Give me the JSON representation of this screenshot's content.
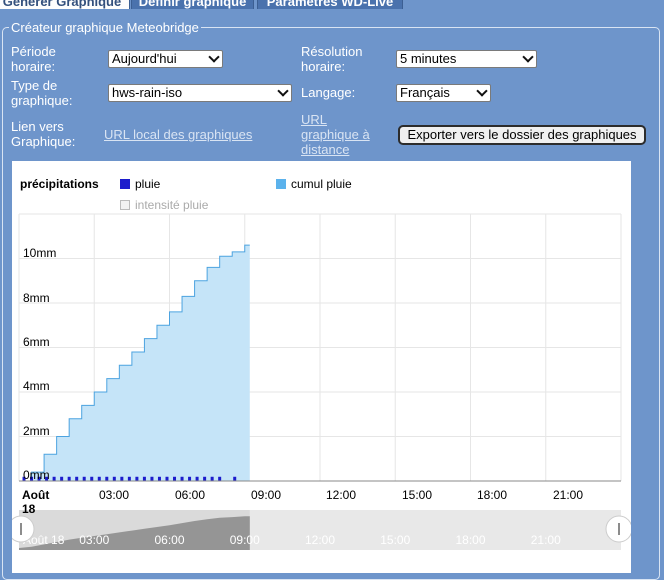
{
  "tabs": [
    {
      "label": "Générer Graphique",
      "active": true
    },
    {
      "label": "Définir graphique",
      "active": false
    },
    {
      "label": "Paramètres WD-Live",
      "active": false
    }
  ],
  "panel": {
    "title": "Créateur graphique Meteobridge",
    "period_label_1": "Période",
    "period_label_2": "horaire:",
    "period_value": "Aujourd'hui",
    "resolution_label_1": "Résolution",
    "resolution_label_2": "horaire:",
    "resolution_value": "5 minutes",
    "type_label_1": "Type de",
    "type_label_2": "graphique:",
    "type_value": "hws-rain-iso",
    "language_label": "Langage:",
    "language_value": "Français",
    "link_label_1": "Lien vers",
    "link_label_2": "Graphique:",
    "local_url": "URL local des graphiques",
    "remote_url_1": "URL",
    "remote_url_2": "graphique à",
    "remote_url_3": "distance",
    "export_button": "Exporter vers le dossier des graphiques"
  },
  "colors": {
    "background": "#6e95cb",
    "rain_bar": "#1c1ccc",
    "cumulative_fill": "#c5e4f8",
    "cumulative_line": "#4ca3e0",
    "navigator_fill": "#7f7f7f"
  },
  "chart_data": {
    "type": "area",
    "y_title": "précipitations",
    "legend": [
      {
        "name": "pluie",
        "color": "#1c1ccc",
        "visible": true
      },
      {
        "name": "cumul pluie",
        "color": "#5bb2ec",
        "visible": true
      },
      {
        "name": "intensité pluie",
        "color": "#cccccc",
        "visible": false
      }
    ],
    "ylim": [
      0,
      12
    ],
    "y_ticks": [
      "0mm",
      "2mm",
      "4mm",
      "6mm",
      "8mm",
      "10mm"
    ],
    "x_ticks": [
      "Août 18",
      "03:00",
      "06:00",
      "09:00",
      "12:00",
      "15:00",
      "18:00",
      "21:00"
    ],
    "navigator_ticks": [
      "Août 18",
      "03:00",
      "06:00",
      "09:00",
      "12:00",
      "15:00",
      "18:00",
      "21:00"
    ],
    "series": [
      {
        "name": "cumul pluie",
        "x_hours": [
          0,
          0.5,
          1,
          1.5,
          2,
          2.5,
          3,
          3.5,
          4,
          4.5,
          5,
          5.5,
          6,
          6.5,
          7,
          7.5,
          8,
          8.5,
          9,
          9.2
        ],
        "values": [
          0,
          0.4,
          1.2,
          2.0,
          2.8,
          3.4,
          4.0,
          4.6,
          5.2,
          5.8,
          6.4,
          7.0,
          7.6,
          8.3,
          9.0,
          9.6,
          10.1,
          10.3,
          10.6,
          10.6
        ]
      },
      {
        "name": "pluie",
        "x_hours": [
          0.2,
          0.5,
          0.8,
          1.1,
          1.4,
          1.7,
          2.0,
          2.3,
          2.6,
          2.9,
          3.2,
          3.5,
          3.8,
          4.1,
          4.4,
          4.7,
          5.0,
          5.3,
          5.6,
          5.9,
          6.2,
          6.5,
          6.8,
          7.1,
          7.4,
          7.7,
          8.0,
          8.6
        ],
        "values": [
          0.1,
          0.1,
          0.1,
          0.1,
          0.1,
          0.1,
          0.1,
          0.1,
          0.1,
          0.1,
          0.1,
          0.1,
          0.1,
          0.1,
          0.1,
          0.1,
          0.1,
          0.1,
          0.1,
          0.1,
          0.1,
          0.1,
          0.1,
          0.1,
          0.1,
          0.1,
          0.1,
          0.1
        ]
      }
    ]
  }
}
